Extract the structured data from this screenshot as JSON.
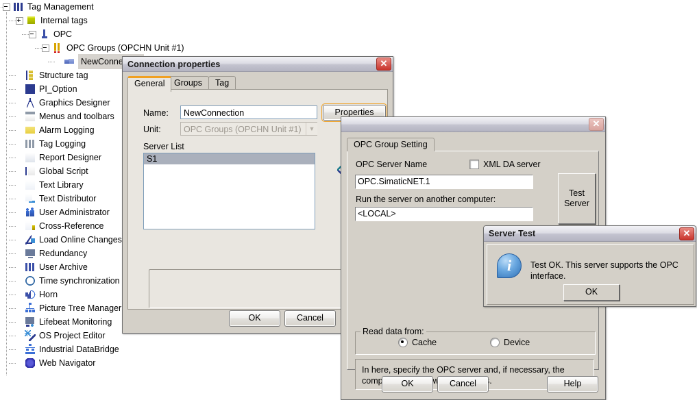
{
  "tree": {
    "nodes": [
      {
        "label": "Tag Management",
        "icon": "bars-blue-icon",
        "depth": 0,
        "expander": "minus",
        "selected": false
      },
      {
        "label": "Internal tags",
        "icon": "cube-icon",
        "depth": 1,
        "expander": "plus",
        "selected": false
      },
      {
        "label": "OPC",
        "icon": "opc-icon",
        "depth": 2,
        "expander": "minus",
        "selected": false
      },
      {
        "label": "OPC Groups (OPCHN Unit #1)",
        "icon": "bars-yellow-icon",
        "depth": 3,
        "expander": "minus",
        "selected": false
      },
      {
        "label": "NewConnection",
        "icon": "connection-icon",
        "depth": 4,
        "expander": "none",
        "selected": true
      },
      {
        "label": "Structure tag",
        "icon": "structure-tag-icon",
        "depth": 1,
        "expander": "none",
        "selected": false
      },
      {
        "label": "PI_Option",
        "icon": "pi-option-icon",
        "depth": 1,
        "expander": "none",
        "selected": false
      },
      {
        "label": "Graphics Designer",
        "icon": "compass-icon",
        "depth": 1,
        "expander": "none",
        "selected": false
      },
      {
        "label": "Menus and toolbars",
        "icon": "menus-toolbars-icon",
        "depth": 1,
        "expander": "none",
        "selected": false
      },
      {
        "label": "Alarm Logging",
        "icon": "alarm-logging-icon",
        "depth": 1,
        "expander": "none",
        "selected": false
      },
      {
        "label": "Tag Logging",
        "icon": "tag-logging-icon",
        "depth": 1,
        "expander": "none",
        "selected": false
      },
      {
        "label": "Report Designer",
        "icon": "report-designer-icon",
        "depth": 1,
        "expander": "none",
        "selected": false
      },
      {
        "label": "Global Script",
        "icon": "global-script-icon",
        "depth": 1,
        "expander": "none",
        "selected": false
      },
      {
        "label": "Text Library",
        "icon": "text-library-icon",
        "depth": 1,
        "expander": "none",
        "selected": false
      },
      {
        "label": "Text Distributor",
        "icon": "text-distributor-icon",
        "depth": 1,
        "expander": "none",
        "selected": false
      },
      {
        "label": "User Administrator",
        "icon": "user-administrator-icon",
        "depth": 1,
        "expander": "none",
        "selected": false
      },
      {
        "label": "Cross-Reference",
        "icon": "cross-reference-icon",
        "depth": 1,
        "expander": "none",
        "selected": false
      },
      {
        "label": "Load Online Changes",
        "icon": "load-online-changes-icon",
        "depth": 1,
        "expander": "none",
        "selected": false
      },
      {
        "label": "Redundancy",
        "icon": "redundancy-icon",
        "depth": 1,
        "expander": "none",
        "selected": false
      },
      {
        "label": "User Archive",
        "icon": "user-archive-icon",
        "depth": 1,
        "expander": "none",
        "selected": false
      },
      {
        "label": "Time synchronization",
        "icon": "clock-icon",
        "depth": 1,
        "expander": "none",
        "selected": false
      },
      {
        "label": "Horn",
        "icon": "horn-icon",
        "depth": 1,
        "expander": "none",
        "selected": false
      },
      {
        "label": "Picture Tree Manager",
        "icon": "picture-tree-icon",
        "depth": 1,
        "expander": "none",
        "selected": false
      },
      {
        "label": "Lifebeat Monitoring",
        "icon": "lifebeat-icon",
        "depth": 1,
        "expander": "none",
        "selected": false
      },
      {
        "label": "OS Project Editor",
        "icon": "os-project-editor-icon",
        "depth": 1,
        "expander": "none",
        "selected": false
      },
      {
        "label": "Industrial DataBridge",
        "icon": "industrial-databridge-icon",
        "depth": 1,
        "expander": "none",
        "selected": false
      },
      {
        "label": "Web Navigator",
        "icon": "web-navigator-icon",
        "depth": 1,
        "expander": "none",
        "selected": false
      }
    ]
  },
  "connection_dialog": {
    "title": "Connection properties",
    "close_glyph": "✕",
    "tabs": [
      {
        "label": "General",
        "active": true
      },
      {
        "label": "Groups",
        "active": false
      },
      {
        "label": "Tag",
        "active": false
      }
    ],
    "name_label": "Name:",
    "name_value": "NewConnection",
    "unit_label": "Unit:",
    "unit_value": "OPC Groups (OPCHN Unit #1)",
    "properties_button": "Properties",
    "server_list_label": "Server List",
    "server_list_items": [
      "S1"
    ],
    "ok_button": "OK",
    "cancel_button": "Cancel"
  },
  "opc_dialog": {
    "title": "",
    "close_glyph": "✕",
    "tabs": [
      {
        "label": "OPC Group Setting",
        "active": true
      }
    ],
    "server_name_label": "OPC Server Name",
    "xml_da_label": "XML DA server",
    "xml_da_checked": false,
    "server_name_value": "OPC.SimaticNET.1",
    "another_computer_label": "Run the server on another computer:",
    "another_computer_value": "<LOCAL>",
    "test_server_button": "Test\nServer",
    "test_server_line1": "Test",
    "test_server_line2": "Server",
    "read_data_group": "Read data from:",
    "radio_cache": "Cache",
    "radio_device": "Device",
    "radio_selected": "Cache",
    "hint_text": "In here, specify the OPC server and, if necessary, the computer that you want to access.",
    "ok_button": "OK",
    "cancel_button": "Cancel",
    "help_button": "Help"
  },
  "server_test_dialog": {
    "title": "Server Test",
    "close_glyph": "✕",
    "icon": "info-icon",
    "icon_glyph": "i",
    "message": "Test OK. This server supports the OPC interface.",
    "ok_button": "OK"
  },
  "colors": {
    "dialog_face": "#d4d0c8",
    "tab_body": "#e9e6e0",
    "selection": "#aab0bc",
    "accent_orange": "#f0a022",
    "close_red": "#c9352c"
  }
}
